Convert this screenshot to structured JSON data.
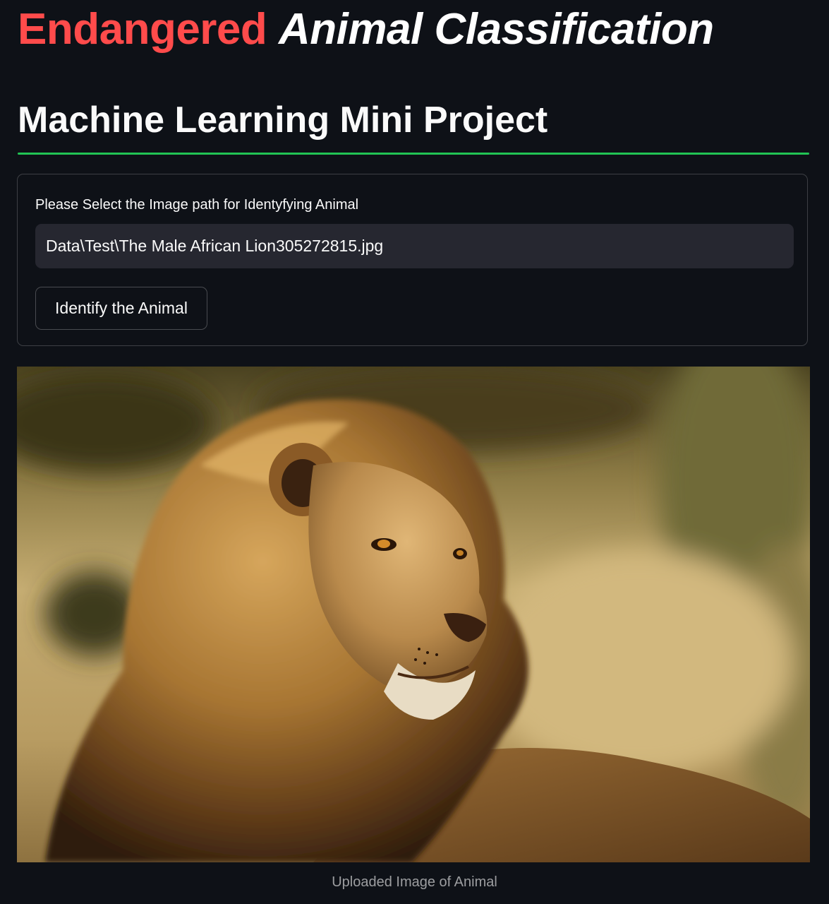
{
  "header": {
    "title_red": "Endangered",
    "title_rest": "Animal Classification",
    "subtitle": "Machine Learning Mini Project",
    "divider_color": "#21c354"
  },
  "form": {
    "label": "Please Select the Image path for Identyfying Animal",
    "input_value": "Data\\Test\\The Male African Lion305272815.jpg",
    "button_label": "Identify the Animal"
  },
  "image": {
    "subject": "male african lion",
    "caption": "Uploaded Image of Animal"
  },
  "colors": {
    "background": "#0e1117",
    "accent_red": "#ff4b4b",
    "input_bg": "#262730"
  }
}
